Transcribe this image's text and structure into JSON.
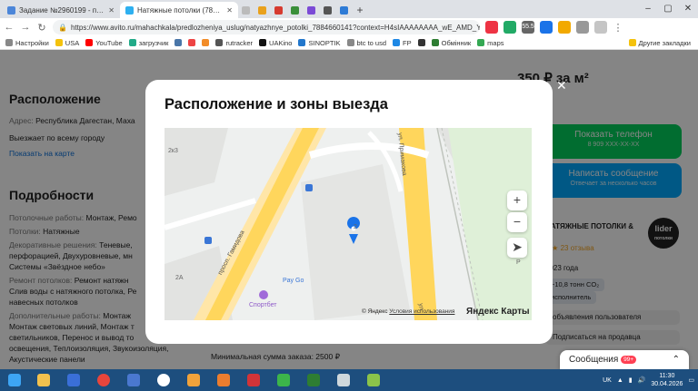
{
  "browser": {
    "tabs": [
      {
        "label": "Задание №2960199 - просмотр з",
        "color": "#4c86d9",
        "active": false
      },
      {
        "label": "Натяжные потолки (7884660141)",
        "color": "#2eb0f0",
        "active": true
      },
      {
        "label": "",
        "color": "#bbbbbb",
        "active": false
      }
    ],
    "url": "https://www.avito.ru/mahachkala/predlozheniya_uslug/natyazhnye_potolki_7884660141?context=H4sIAAAAAAAA_wE_AMD_YToy...",
    "bookmarks": [
      "Настройки",
      "USA",
      "YouTube",
      "загрузчик",
      "",
      "",
      "",
      "rutracker",
      "UAKino",
      "SINOPTIK",
      "btc to usd",
      "FP",
      "",
      "Обмінник",
      "maps"
    ],
    "other_bookmarks": "Другие закладки",
    "ltc_badge": "55.5"
  },
  "page": {
    "price": "350 ₽ за м²",
    "location_heading": "Расположение",
    "address_label": "Адрес:",
    "address_value": "Республика Дагестан, Маха",
    "travel_note": "Выезжает по всему городу",
    "show_on_map": "Показать на карте",
    "details_heading": "Подробности",
    "details": [
      {
        "label": "Потолочные работы:",
        "value": "Монтаж, Ремо"
      },
      {
        "label": "Потолки:",
        "value": "Натяжные"
      },
      {
        "label": "Декоративные решения:",
        "value": "Теневые, "
      },
      {
        "label": "",
        "value": "перфорацией, Двухуровневые, мн"
      },
      {
        "label": "",
        "value": "Системы «Звёздное небо»"
      },
      {
        "label": "Ремонт потолков:",
        "value": "Ремонт натяжн"
      },
      {
        "label": "",
        "value": "Слив воды с натяжного потолка, Ре"
      },
      {
        "label": "",
        "value": "навесных потолков"
      },
      {
        "label": "Дополнительные работы:",
        "value": "Монтаж"
      },
      {
        "label": "",
        "value": "Монтаж световых линий, Монтаж т"
      },
      {
        "label": "",
        "value": "светильников, Перенос и вывод то"
      },
      {
        "label": "",
        "value": "освещения, Теплоизоляция, Звукоизоляция,"
      },
      {
        "label": "",
        "value": "Акустические панели"
      }
    ],
    "min_order": "Минимальная сумма заказа: 2500 ₽",
    "show_phone": "Показать телефон",
    "phone_masked": "8 909 XXX-XX-XX",
    "write_message": "Написать сообщение",
    "reply_time": "Отвечает за несколько часов",
    "seller_name": "НАТЯЖНЫЕ ПОТОЛКИ &",
    "seller_logo": "lider",
    "seller_logo_sub": "потолки",
    "rating": "★★ 23 отзыва",
    "since": "2023 года",
    "eco": "−10,8 тонн CO₂",
    "exec": "исполнитель",
    "user_ads": "объявления пользователя",
    "subscribe": "Подписаться на продавца",
    "messages_label": "Сообщения",
    "messages_count": "99+"
  },
  "modal": {
    "title": "Расположение и зоны выезда",
    "close": "✕",
    "map": {
      "street_primakova": "ул. Примакова",
      "street_gamidova": "просп. Гамидова",
      "place_label": "Pay Go",
      "place_label2": "Спортбет",
      "house_2x3": "2к3",
      "house_2": "2",
      "house_2a": "2А",
      "zoom_in": "+",
      "zoom_out": "−",
      "locate_label": "Р",
      "copyright": "© Яндекс",
      "terms": "Условия использования",
      "brand": "Яндекс Карты",
      "street_right": "ул"
    }
  },
  "taskbar": {
    "lang": "UK",
    "time": "11:30",
    "date": "30.04.2026"
  }
}
